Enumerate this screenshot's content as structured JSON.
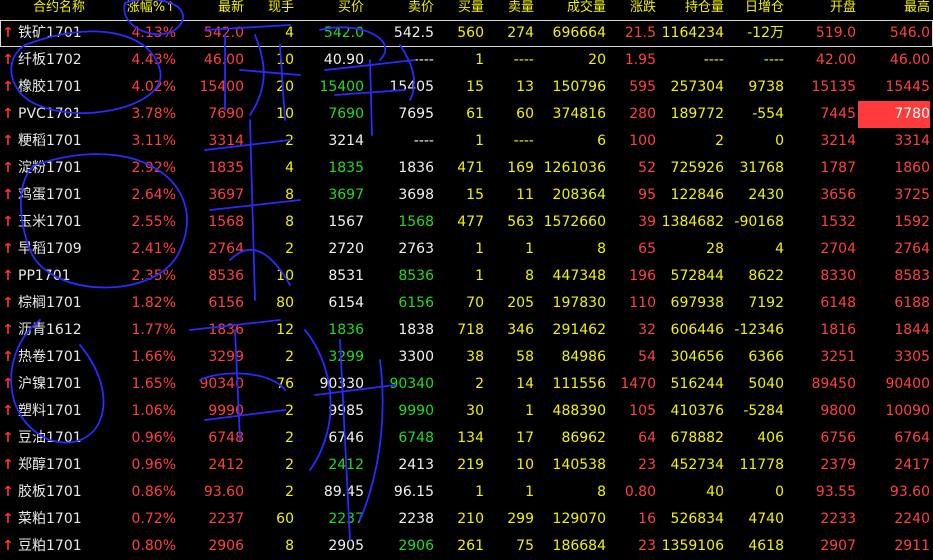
{
  "columns": [
    {
      "key": "name",
      "label": "合约名称"
    },
    {
      "key": "pct",
      "label": "涨幅%↑"
    },
    {
      "key": "last",
      "label": "最新"
    },
    {
      "key": "hand",
      "label": "现手"
    },
    {
      "key": "bid",
      "label": "买价"
    },
    {
      "key": "ask",
      "label": "卖价"
    },
    {
      "key": "bidvol",
      "label": "买量"
    },
    {
      "key": "askvol",
      "label": "卖量"
    },
    {
      "key": "volume",
      "label": "成交量"
    },
    {
      "key": "change",
      "label": "涨跌"
    },
    {
      "key": "oi",
      "label": "持仓量"
    },
    {
      "key": "oichg",
      "label": "日增仓"
    },
    {
      "key": "open",
      "label": "开盘"
    },
    {
      "key": "high",
      "label": "最高"
    }
  ],
  "rows": [
    {
      "name": "铁矿1701",
      "pct": "4.13%",
      "last": "542.0",
      "hand": "4",
      "bid": "542.0",
      "ask": "542.5",
      "bidvol": "560",
      "askvol": "274",
      "volume": "696664",
      "change": "21.5",
      "oi": "1164234",
      "oichg": "-12万",
      "open": "519.0",
      "high": "546.0"
    },
    {
      "name": "纤板1702",
      "pct": "4.43%",
      "last": "46.00",
      "hand": "10",
      "bid": "40.90",
      "ask": "----",
      "bidvol": "1",
      "askvol": "----",
      "volume": "20",
      "change": "1.95",
      "oi": "----",
      "oichg": "----",
      "open": "42.00",
      "high": "46.00"
    },
    {
      "name": "橡胶1701",
      "pct": "4.02%",
      "last": "15400",
      "hand": "20",
      "bid": "15400",
      "ask": "15405",
      "bidvol": "15",
      "askvol": "13",
      "volume": "150796",
      "change": "595",
      "oi": "257304",
      "oichg": "9738",
      "open": "15135",
      "high": "15445"
    },
    {
      "name": "PVC1701",
      "pct": "3.78%",
      "last": "7690",
      "hand": "10",
      "bid": "7690",
      "ask": "7695",
      "bidvol": "61",
      "askvol": "60",
      "volume": "374816",
      "change": "280",
      "oi": "189772",
      "oichg": "-554",
      "open": "7445",
      "high": "7780"
    },
    {
      "name": "粳稻1701",
      "pct": "3.11%",
      "last": "3314",
      "hand": "2",
      "bid": "3214",
      "ask": "----",
      "bidvol": "1",
      "askvol": "----",
      "volume": "6",
      "change": "100",
      "oi": "2",
      "oichg": "0",
      "open": "3214",
      "high": "3314"
    },
    {
      "name": "淀粉1701",
      "pct": "2.92%",
      "last": "1835",
      "hand": "4",
      "bid": "1835",
      "ask": "1836",
      "bidvol": "471",
      "askvol": "169",
      "volume": "1261036",
      "change": "52",
      "oi": "725926",
      "oichg": "31768",
      "open": "1787",
      "high": "1860"
    },
    {
      "name": "鸡蛋1701",
      "pct": "2.64%",
      "last": "3697",
      "hand": "8",
      "bid": "3697",
      "ask": "3698",
      "bidvol": "15",
      "askvol": "11",
      "volume": "208364",
      "change": "95",
      "oi": "122846",
      "oichg": "2430",
      "open": "3656",
      "high": "3725"
    },
    {
      "name": "玉米1701",
      "pct": "2.55%",
      "last": "1568",
      "hand": "8",
      "bid": "1567",
      "ask": "1568",
      "bidvol": "477",
      "askvol": "563",
      "volume": "1572660",
      "change": "39",
      "oi": "1384682",
      "oichg": "-90168",
      "open": "1532",
      "high": "1592"
    },
    {
      "name": "早稻1709",
      "pct": "2.41%",
      "last": "2764",
      "hand": "2",
      "bid": "2720",
      "ask": "2763",
      "bidvol": "1",
      "askvol": "1",
      "volume": "8",
      "change": "65",
      "oi": "28",
      "oichg": "4",
      "open": "2704",
      "high": "2764"
    },
    {
      "name": "PP1701",
      "pct": "2.35%",
      "last": "8536",
      "hand": "10",
      "bid": "8531",
      "ask": "8536",
      "bidvol": "1",
      "askvol": "8",
      "volume": "447348",
      "change": "196",
      "oi": "572844",
      "oichg": "8622",
      "open": "8330",
      "high": "8583"
    },
    {
      "name": "棕榈1701",
      "pct": "1.82%",
      "last": "6156",
      "hand": "80",
      "bid": "6154",
      "ask": "6156",
      "bidvol": "70",
      "askvol": "205",
      "volume": "197830",
      "change": "110",
      "oi": "697938",
      "oichg": "7192",
      "open": "6148",
      "high": "6188"
    },
    {
      "name": "沥青1612",
      "pct": "1.77%",
      "last": "1836",
      "hand": "12",
      "bid": "1836",
      "ask": "1838",
      "bidvol": "718",
      "askvol": "346",
      "volume": "291462",
      "change": "32",
      "oi": "606446",
      "oichg": "-12346",
      "open": "1816",
      "high": "1844"
    },
    {
      "name": "热卷1701",
      "pct": "1.66%",
      "last": "3299",
      "hand": "2",
      "bid": "3299",
      "ask": "3300",
      "bidvol": "38",
      "askvol": "58",
      "volume": "84986",
      "change": "54",
      "oi": "304656",
      "oichg": "6366",
      "open": "3251",
      "high": "3305"
    },
    {
      "name": "沪镍1701",
      "pct": "1.65%",
      "last": "90340",
      "hand": "76",
      "bid": "90330",
      "ask": "90340",
      "bidvol": "2",
      "askvol": "14",
      "volume": "111556",
      "change": "1470",
      "oi": "516244",
      "oichg": "5040",
      "open": "89450",
      "high": "90400"
    },
    {
      "name": "塑料1701",
      "pct": "1.06%",
      "last": "9990",
      "hand": "2",
      "bid": "9985",
      "ask": "9990",
      "bidvol": "30",
      "askvol": "1",
      "volume": "488390",
      "change": "105",
      "oi": "410376",
      "oichg": "-5284",
      "open": "9800",
      "high": "10090"
    },
    {
      "name": "豆油1701",
      "pct": "0.96%",
      "last": "6748",
      "hand": "2",
      "bid": "6746",
      "ask": "6748",
      "bidvol": "134",
      "askvol": "17",
      "volume": "86962",
      "change": "64",
      "oi": "678882",
      "oichg": "406",
      "open": "6756",
      "high": "6764"
    },
    {
      "name": "郑醇1701",
      "pct": "0.96%",
      "last": "2412",
      "hand": "2",
      "bid": "2412",
      "ask": "2413",
      "bidvol": "219",
      "askvol": "10",
      "volume": "140538",
      "change": "23",
      "oi": "452734",
      "oichg": "11778",
      "open": "2379",
      "high": "2417"
    },
    {
      "name": "胶板1701",
      "pct": "0.86%",
      "last": "93.60",
      "hand": "2",
      "bid": "89.45",
      "ask": "96.15",
      "bidvol": "1",
      "askvol": "1",
      "volume": "8",
      "change": "0.80",
      "oi": "40",
      "oichg": "0",
      "open": "93.55",
      "high": "93.60"
    },
    {
      "name": "菜粕1701",
      "pct": "0.72%",
      "last": "2237",
      "hand": "60",
      "bid": "2237",
      "ask": "2238",
      "bidvol": "210",
      "askvol": "299",
      "volume": "129070",
      "change": "16",
      "oi": "526834",
      "oichg": "4740",
      "open": "2233",
      "high": "2240"
    },
    {
      "name": "豆粕1701",
      "pct": "0.80%",
      "last": "2906",
      "hand": "8",
      "bid": "2905",
      "ask": "2906",
      "bidvol": "261",
      "askvol": "75",
      "volume": "186684",
      "change": "23",
      "oi": "1359106",
      "oichg": "4618",
      "open": "2907",
      "high": "2911"
    }
  ],
  "row_indicator": "up-arrow-icon",
  "colors": {
    "background": "#000000",
    "header_text": "#f2f200",
    "up": "#ff4040",
    "down_or_buy": "#20dc20",
    "neutral": "#f0f0f0",
    "highlight_cell": "#ff3b3b",
    "scribble_ink": "#2a2aff"
  }
}
